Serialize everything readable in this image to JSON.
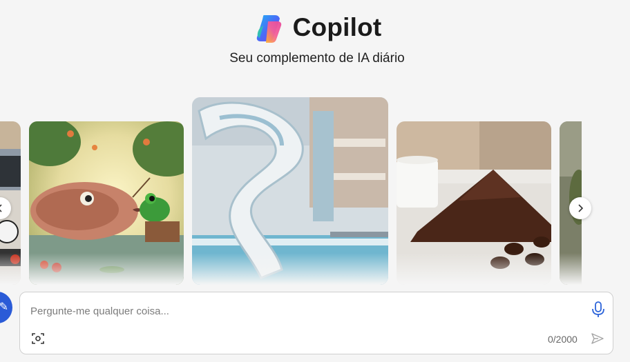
{
  "header": {
    "title": "Copilot",
    "tagline": "Seu complemento de IA diário"
  },
  "carousel": {
    "cards": [
      {
        "id": "car-sports",
        "icon": "partial-image"
      },
      {
        "id": "fish-frog",
        "icon": "image"
      },
      {
        "id": "water-slide",
        "icon": "image"
      },
      {
        "id": "coffee-powder",
        "icon": "image"
      },
      {
        "id": "partial-right",
        "icon": "partial-image"
      }
    ],
    "prev_icon": "chevron-left-icon",
    "next_icon": "chevron-right-icon"
  },
  "composer": {
    "placeholder": "Pergunte-me qualquer coisa...",
    "value": "",
    "counter": "0/2000",
    "icons": [
      "microphone-icon",
      "camera-scan-icon",
      "send-icon"
    ]
  },
  "colors": {
    "background": "#f5f5f5",
    "accent": "#2a5bd7",
    "mic": "#2b63d9"
  }
}
